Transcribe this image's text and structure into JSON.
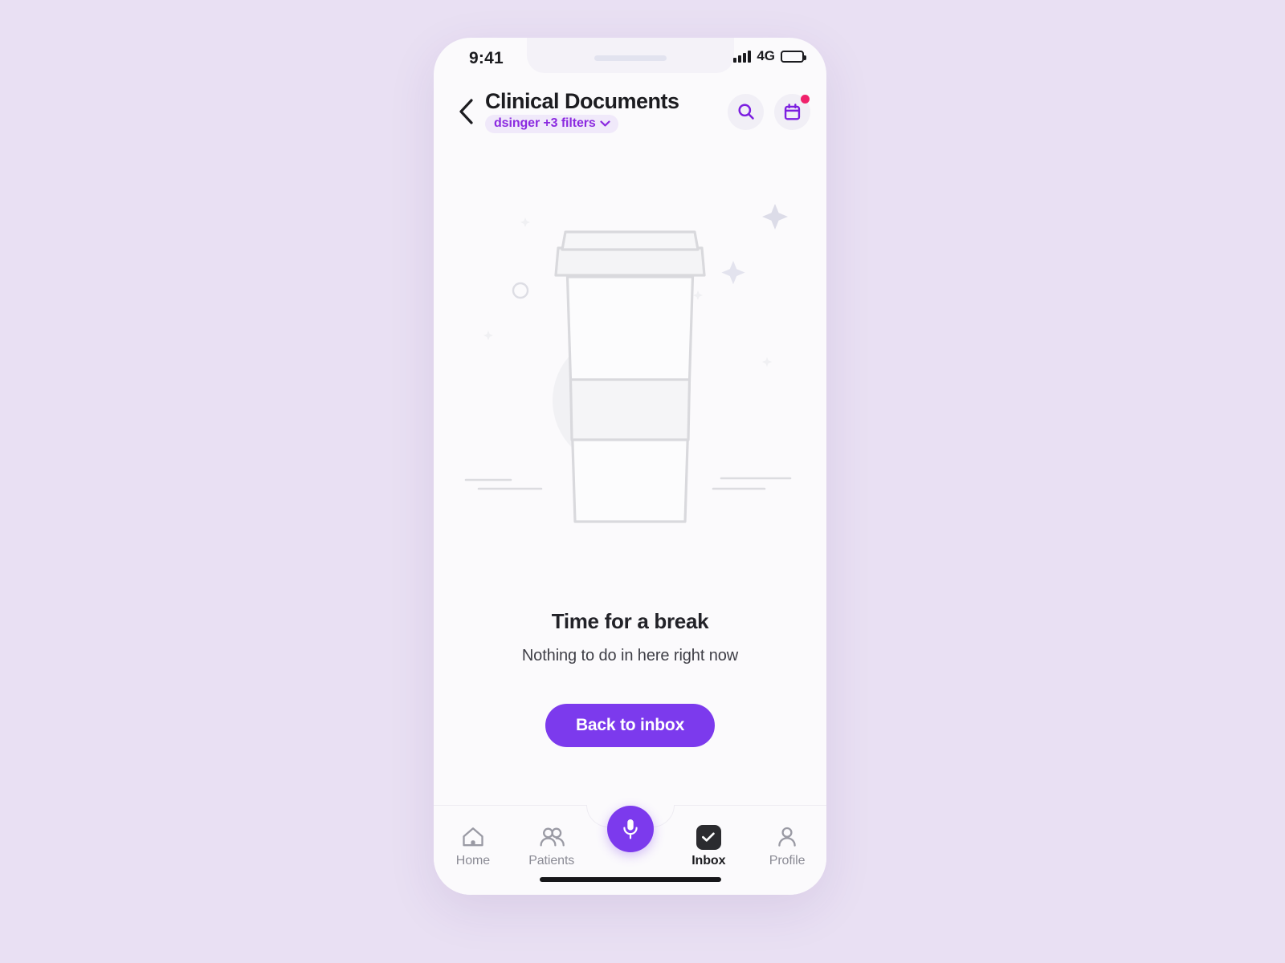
{
  "background_color": "#e9e0f3",
  "accent_color": "#7c3aed",
  "badge_color": "#f0216b",
  "status_bar": {
    "time": "9:41",
    "network": "4G",
    "signal_icon": "signal-bars-icon",
    "battery_icon": "battery-icon"
  },
  "header": {
    "back_icon": "chevron-left-icon",
    "title": "Clinical Documents",
    "filter_chip": {
      "label": "dsinger +3 filters",
      "chevron_icon": "chevron-down-icon"
    },
    "actions": [
      {
        "name": "search-button",
        "icon": "search-icon",
        "has_badge": false
      },
      {
        "name": "calendar-button",
        "icon": "calendar-icon",
        "has_badge": true
      }
    ]
  },
  "empty_state": {
    "illustration": "coffee-cup-illustration",
    "title": "Time for a break",
    "subtitle": "Nothing to do in here right now",
    "cta_label": "Back to inbox"
  },
  "bottom_nav": {
    "items": [
      {
        "label": "Home",
        "icon": "home-icon",
        "active": false
      },
      {
        "label": "Patients",
        "icon": "patients-icon",
        "active": false
      },
      {
        "label": "",
        "icon": "microphone-icon",
        "active": false
      },
      {
        "label": "Inbox",
        "icon": "inbox-check-icon",
        "active": true
      },
      {
        "label": "Profile",
        "icon": "profile-icon",
        "active": false
      }
    ],
    "fab": {
      "name": "voice-record-button",
      "icon": "microphone-icon"
    }
  }
}
